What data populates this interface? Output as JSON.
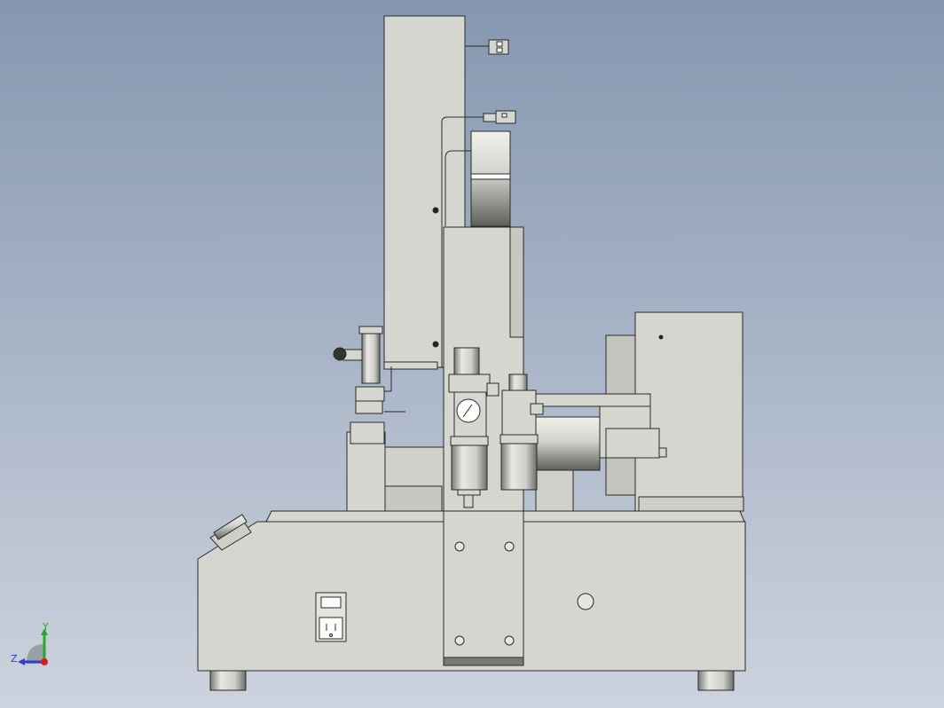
{
  "viewport": {
    "background_top": "#8597b0",
    "background_bottom": "#cdd3de",
    "part_fill": "#d6d6d0",
    "part_fill_dark": "#a9a9a3",
    "edge_color": "#2a2a2a"
  },
  "triad": {
    "y_label": "Y",
    "z_label": "Z",
    "y_color": "#1fae1f",
    "z_color": "#2a3fd6",
    "x_color": "#e01818"
  }
}
